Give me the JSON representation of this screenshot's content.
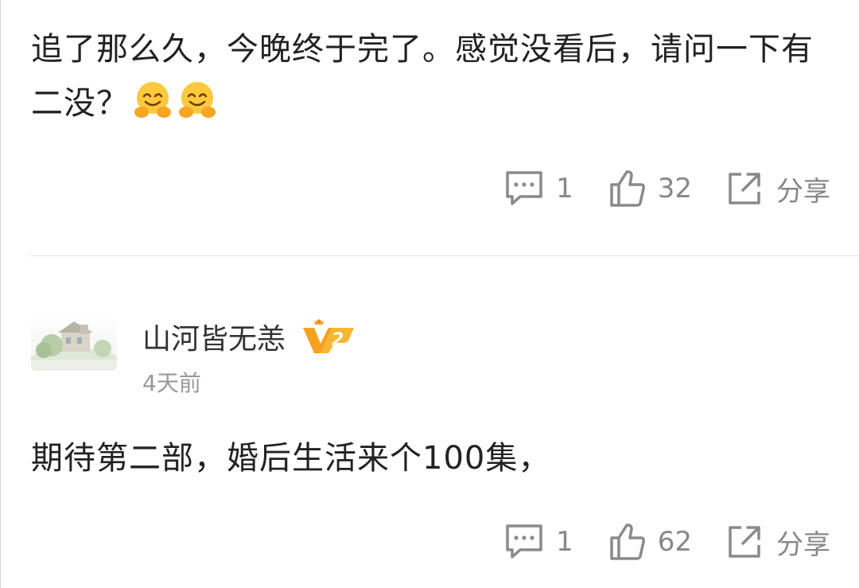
{
  "comments": [
    {
      "text": "追了那么久，今晚终于完了。感觉没看后，请问一下有二没？",
      "emojis": [
        "hugging-face-emoji",
        "hugging-face-emoji"
      ],
      "reply_count": "1",
      "like_count": "32",
      "share_label": "分享"
    },
    {
      "username": "山河皆无恙",
      "vip_level": "V2",
      "time": "4天前",
      "text": "期待第二部，婚后生活来个100集，",
      "reply_count": "1",
      "like_count": "62",
      "share_label": "分享"
    }
  ],
  "colors": {
    "text": "#222222",
    "muted": "#888888",
    "divider": "#e6e6e6",
    "vip_gold": "#f5a623"
  }
}
